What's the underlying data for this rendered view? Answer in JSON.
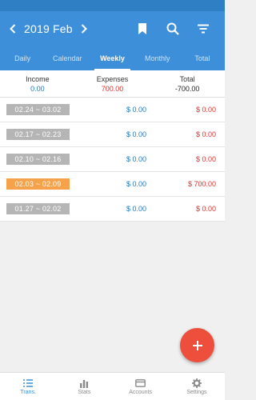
{
  "header": {
    "month": "2019 Feb",
    "prev_icon": "chevron-left-icon",
    "next_icon": "chevron-right-icon",
    "actions": [
      "bookmark-icon",
      "search-icon",
      "filter-icon"
    ]
  },
  "tabs": [
    {
      "label": "Daily"
    },
    {
      "label": "Calendar"
    },
    {
      "label": "Weekly"
    },
    {
      "label": "Monthly"
    },
    {
      "label": "Total"
    }
  ],
  "active_tab": "Weekly",
  "summary": {
    "income_label": "Income",
    "income_value": "0.00",
    "expenses_label": "Expenses",
    "expenses_value": "700.00",
    "total_label": "Total",
    "total_value": "-700.00"
  },
  "weeks": [
    {
      "range": "02.24 ~ 03.02",
      "income": "$ 0.00",
      "expense": "$ 0.00",
      "highlight": false
    },
    {
      "range": "02.17 ~ 02.23",
      "income": "$ 0.00",
      "expense": "$ 0.00",
      "highlight": false
    },
    {
      "range": "02.10 ~ 02.16",
      "income": "$ 0.00",
      "expense": "$ 0.00",
      "highlight": false
    },
    {
      "range": "02.03 ~ 02.09",
      "income": "$ 0.00",
      "expense": "$ 700.00",
      "highlight": true
    },
    {
      "range": "01.27 ~ 02.02",
      "income": "$ 0.00",
      "expense": "$ 0.00",
      "highlight": false
    }
  ],
  "fab_icon": "plus-icon",
  "bottom_nav": [
    {
      "label": "Trans.",
      "icon": "list-icon"
    },
    {
      "label": "Stats",
      "icon": "bar-chart-icon"
    },
    {
      "label": "Accounts",
      "icon": "wallet-icon"
    },
    {
      "label": "Settings",
      "icon": "gear-icon"
    }
  ],
  "colors": {
    "primary": "#3d8fda",
    "income": "#1a7ac0",
    "expense": "#e0302b",
    "fab": "#ee4f3d",
    "highlight_chip": "#f5a24a",
    "chip": "#b5b5b5"
  }
}
